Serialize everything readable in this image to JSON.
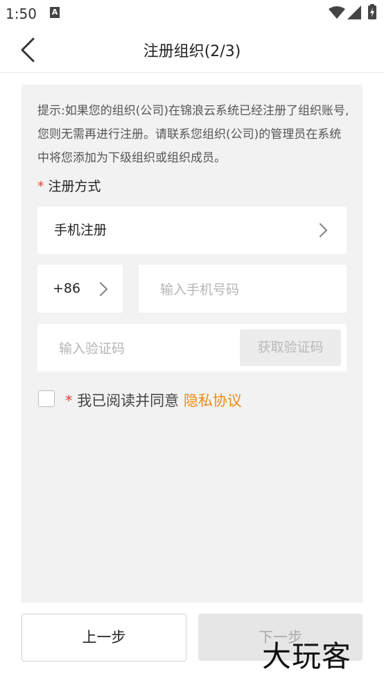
{
  "status_bar": {
    "time": "1:50",
    "notif_icon_letter": "A"
  },
  "header": {
    "title": "注册组织(2/3)"
  },
  "tip": {
    "text": "提示:如果您的组织(公司)在锦浪云系统已经注册了组织账号,您则无需再进行注册。请联系您组织(公司)的管理员在系统中将您添加为下级组织或组织成员。"
  },
  "registration": {
    "required_mark": "*",
    "label": "注册方式",
    "method_value": "手机注册"
  },
  "phone": {
    "country_code": "+86",
    "placeholder": "输入手机号码"
  },
  "verification": {
    "placeholder": "输入验证码",
    "get_code_label": "获取验证码"
  },
  "agreement": {
    "required_mark": "*",
    "text": "我已阅读并同意",
    "link_text": "隐私协议",
    "checked": false
  },
  "footer": {
    "prev_label": "上一步",
    "next_label": "下一步"
  },
  "watermark": {
    "text": "大玩客"
  },
  "colors": {
    "accent": "#f08a12",
    "required": "#e0433b",
    "panel_bg": "#f2f2f2"
  }
}
